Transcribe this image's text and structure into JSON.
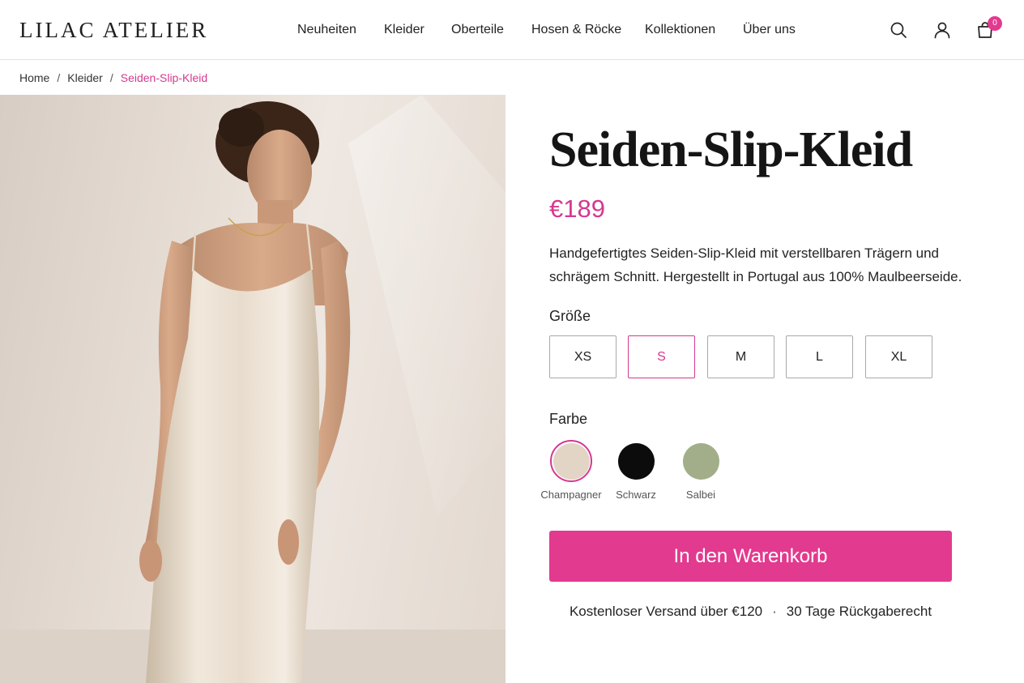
{
  "header": {
    "logo": "LILAC ATELIER",
    "nav": [
      "Neuheiten",
      "Kleider",
      "Oberteile",
      "Hosen & Röcke",
      "Kollektionen",
      "Über uns"
    ],
    "icons": [
      "search-icon",
      "user-icon",
      "cart-icon"
    ],
    "cart_count": "0"
  },
  "breadcrumb": [
    "Home",
    "Kleider",
    "Seiden-Slip-Kleid"
  ],
  "product": {
    "title": "Seiden-Slip-Kleid",
    "price": "€189",
    "description": "Handgefertigtes Seiden-Slip-Kleid mit verstellbaren Trägern und schrägem Schnitt. Hergestellt in Portugal aus 100% Maulbeerseide.",
    "size_label": "Größe",
    "sizes": [
      "XS",
      "S",
      "M",
      "L",
      "XL"
    ],
    "selected_size": "S",
    "color_label": "Farbe",
    "colors": [
      {
        "name": "Champagner",
        "hex": "#e2d5c6"
      },
      {
        "name": "Schwarz",
        "hex": "#0c0c0c"
      },
      {
        "name": "Salbei",
        "hex": "#a2ae8a"
      }
    ],
    "selected_color": "Champagner",
    "add_to_cart": "In den Warenkorb",
    "shipping": "Kostenloser Versand über €120",
    "returns": "30 Tage Rückgaberecht"
  },
  "colors": {
    "accent": "#e23a8f",
    "accent_text": "#d6388f",
    "border": "#a9a9a9"
  }
}
